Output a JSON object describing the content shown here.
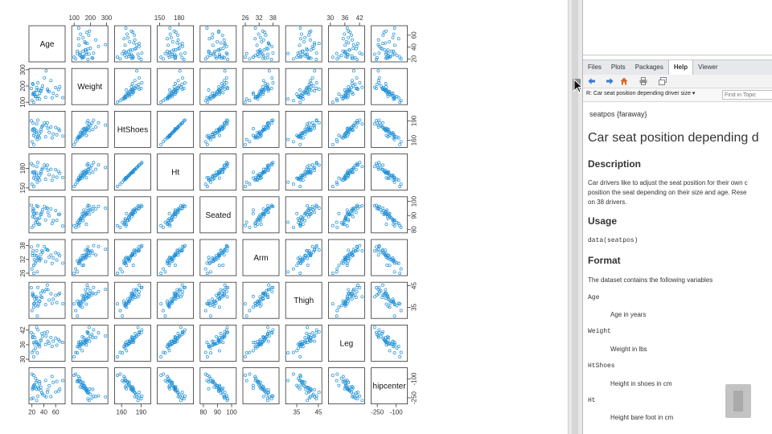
{
  "colors": {
    "point": "#1f8fd6",
    "panel_border": "#333333",
    "axis_text": "#333333"
  },
  "chart_data": {
    "type": "scatter",
    "title": "",
    "variables": [
      "Age",
      "Weight",
      "HtShoes",
      "Ht",
      "Seated",
      "Arm",
      "Thigh",
      "Leg",
      "hipcenter"
    ],
    "axis_ticks": {
      "Age": [
        20,
        40,
        60
      ],
      "Weight": [
        100,
        200,
        300
      ],
      "HtShoes": [
        160,
        190
      ],
      "Ht": [
        150,
        180
      ],
      "Seated": [
        80,
        90,
        100
      ],
      "Arm": [
        26,
        32,
        38
      ],
      "Thigh": [
        35,
        45
      ],
      "Leg": [
        30,
        36,
        42
      ],
      "hipcenter": [
        -250,
        -100
      ]
    },
    "ranges": {
      "Age": [
        19,
        72
      ],
      "Weight": [
        100,
        293
      ],
      "HtShoes": [
        152.8,
        201.2
      ],
      "Ht": [
        150.2,
        198.4
      ],
      "Seated": [
        79.4,
        101.6
      ],
      "Arm": [
        26,
        39.6
      ],
      "Thigh": [
        31,
        45.5
      ],
      "Leg": [
        30.2,
        43.1
      ],
      "hipcenter": [
        -279.2,
        -30.9
      ]
    },
    "observations": [
      {
        "Age": 46,
        "Weight": 180,
        "HtShoes": 187.2,
        "Ht": 184.9,
        "Seated": 95.2,
        "Arm": 36.1,
        "Thigh": 45.3,
        "Leg": 41.3,
        "hipcenter": -206.3
      },
      {
        "Age": 31,
        "Weight": 175,
        "HtShoes": 167.5,
        "Ht": 165.5,
        "Seated": 83.8,
        "Arm": 32.9,
        "Thigh": 36.5,
        "Leg": 35.9,
        "hipcenter": -178.2
      },
      {
        "Age": 23,
        "Weight": 100,
        "HtShoes": 153.6,
        "Ht": 152.2,
        "Seated": 82.9,
        "Arm": 26.0,
        "Thigh": 36.6,
        "Leg": 31.0,
        "hipcenter": -71.7
      },
      {
        "Age": 19,
        "Weight": 185,
        "HtShoes": 190.3,
        "Ht": 187.4,
        "Seated": 97.3,
        "Arm": 37.4,
        "Thigh": 44.1,
        "Leg": 41.0,
        "hipcenter": -257.7
      },
      {
        "Age": 23,
        "Weight": 159,
        "HtShoes": 178.0,
        "Ht": 174.1,
        "Seated": 93.9,
        "Arm": 29.5,
        "Thigh": 40.1,
        "Leg": 36.9,
        "hipcenter": -173.2
      },
      {
        "Age": 47,
        "Weight": 170,
        "HtShoes": 178.7,
        "Ht": 177.0,
        "Seated": 92.4,
        "Arm": 36.0,
        "Thigh": 43.2,
        "Leg": 37.4,
        "hipcenter": -185.2
      },
      {
        "Age": 30,
        "Weight": 137,
        "HtShoes": 165.7,
        "Ht": 164.6,
        "Seated": 87.7,
        "Arm": 32.5,
        "Thigh": 35.6,
        "Leg": 36.2,
        "hipcenter": -164.8
      },
      {
        "Age": 28,
        "Weight": 192,
        "HtShoes": 185.3,
        "Ht": 182.7,
        "Seated": 96.9,
        "Arm": 35.8,
        "Thigh": 39.9,
        "Leg": 43.1,
        "hipcenter": -270.9
      },
      {
        "Age": 23,
        "Weight": 150,
        "HtShoes": 167.6,
        "Ht": 165.0,
        "Seated": 91.4,
        "Arm": 29.4,
        "Thigh": 35.1,
        "Leg": 33.5,
        "hipcenter": -151.8
      },
      {
        "Age": 29,
        "Weight": 120,
        "HtShoes": 161.2,
        "Ht": 158.7,
        "Seated": 85.2,
        "Arm": 26.6,
        "Thigh": 31.0,
        "Leg": 32.6,
        "hipcenter": -113.7
      },
      {
        "Age": 52,
        "Weight": 233,
        "HtShoes": 180.5,
        "Ht": 178.6,
        "Seated": 94.7,
        "Arm": 33.9,
        "Thigh": 41.3,
        "Leg": 39.0,
        "hipcenter": -240.4
      },
      {
        "Age": 72,
        "Weight": 128,
        "HtShoes": 166.6,
        "Ht": 165.9,
        "Seated": 82.6,
        "Arm": 30.4,
        "Thigh": 36.7,
        "Leg": 36.9,
        "hipcenter": -113.3
      },
      {
        "Age": 33,
        "Weight": 120,
        "HtShoes": 163.7,
        "Ht": 162.0,
        "Seated": 83.9,
        "Arm": 31.4,
        "Thigh": 37.9,
        "Leg": 35.2,
        "hipcenter": -122.6
      },
      {
        "Age": 27,
        "Weight": 137,
        "HtShoes": 172.0,
        "Ht": 169.7,
        "Seated": 87.3,
        "Arm": 31.3,
        "Thigh": 37.8,
        "Leg": 37.3,
        "hipcenter": -126.5
      },
      {
        "Age": 30,
        "Weight": 220,
        "HtShoes": 191.3,
        "Ht": 189.0,
        "Seated": 96.4,
        "Arm": 38.0,
        "Thigh": 44.2,
        "Leg": 42.1,
        "hipcenter": -236.0
      },
      {
        "Age": 37,
        "Weight": 185,
        "HtShoes": 181.0,
        "Ht": 178.4,
        "Seated": 92.3,
        "Arm": 35.8,
        "Thigh": 39.6,
        "Leg": 40.6,
        "hipcenter": -210.8
      },
      {
        "Age": 21,
        "Weight": 150,
        "HtShoes": 175.6,
        "Ht": 173.8,
        "Seated": 89.2,
        "Arm": 33.7,
        "Thigh": 40.5,
        "Leg": 39.3,
        "hipcenter": -168.7
      },
      {
        "Age": 67,
        "Weight": 195,
        "HtShoes": 175.1,
        "Ht": 172.5,
        "Seated": 91.0,
        "Arm": 33.6,
        "Thigh": 41.5,
        "Leg": 37.4,
        "hipcenter": -179.6
      },
      {
        "Age": 35,
        "Weight": 168,
        "HtShoes": 173.4,
        "Ht": 171.9,
        "Seated": 90.5,
        "Arm": 32.4,
        "Thigh": 39.9,
        "Leg": 37.9,
        "hipcenter": -165.4
      },
      {
        "Age": 21,
        "Weight": 215,
        "HtShoes": 176.6,
        "Ht": 174.2,
        "Seated": 93.1,
        "Arm": 34.6,
        "Thigh": 41.6,
        "Leg": 38.9,
        "hipcenter": -183.0
      },
      {
        "Age": 43,
        "Weight": 130,
        "HtShoes": 165.5,
        "Ht": 163.2,
        "Seated": 86.8,
        "Arm": 31.1,
        "Thigh": 36.3,
        "Leg": 36.1,
        "hipcenter": -111.9
      },
      {
        "Age": 56,
        "Weight": 155,
        "HtShoes": 169.8,
        "Ht": 167.9,
        "Seated": 86.4,
        "Arm": 32.6,
        "Thigh": 38.8,
        "Leg": 37.4,
        "hipcenter": -127.2
      },
      {
        "Age": 54,
        "Weight": 127,
        "HtShoes": 163.9,
        "Ht": 161.8,
        "Seated": 84.3,
        "Arm": 30.3,
        "Thigh": 36.9,
        "Leg": 35.3,
        "hipcenter": -81.4
      },
      {
        "Age": 25,
        "Weight": 160,
        "HtShoes": 176.8,
        "Ht": 174.8,
        "Seated": 91.6,
        "Arm": 33.8,
        "Thigh": 38.9,
        "Leg": 38.9,
        "hipcenter": -160.1
      },
      {
        "Age": 41,
        "Weight": 250,
        "HtShoes": 187.2,
        "Ht": 185.3,
        "Seated": 96.5,
        "Arm": 37.6,
        "Thigh": 42.3,
        "Leg": 40.9,
        "hipcenter": -233.2
      },
      {
        "Age": 35,
        "Weight": 173,
        "HtShoes": 176.6,
        "Ht": 174.5,
        "Seated": 91.2,
        "Arm": 34.2,
        "Thigh": 41.6,
        "Leg": 37.7,
        "hipcenter": -190.6
      },
      {
        "Age": 22,
        "Weight": 210,
        "HtShoes": 186.6,
        "Ht": 184.5,
        "Seated": 94.9,
        "Arm": 35.7,
        "Thigh": 40.8,
        "Leg": 40.2,
        "hipcenter": -251.6
      },
      {
        "Age": 44,
        "Weight": 293,
        "HtShoes": 183.4,
        "Ht": 181.2,
        "Seated": 95.2,
        "Arm": 36.4,
        "Thigh": 43.3,
        "Leg": 39.6,
        "hipcenter": -242.3
      },
      {
        "Age": 28,
        "Weight": 175,
        "HtShoes": 174.7,
        "Ht": 172.7,
        "Seated": 91.5,
        "Arm": 33.6,
        "Thigh": 39.2,
        "Leg": 37.0,
        "hipcenter": -182.5
      },
      {
        "Age": 60,
        "Weight": 190,
        "HtShoes": 179.8,
        "Ht": 178.0,
        "Seated": 93.6,
        "Arm": 34.9,
        "Thigh": 40.6,
        "Leg": 38.7,
        "hipcenter": -204.0
      },
      {
        "Age": 26,
        "Weight": 135,
        "HtShoes": 165.2,
        "Ht": 163.6,
        "Seated": 84.9,
        "Arm": 30.5,
        "Thigh": 35.8,
        "Leg": 34.6,
        "hipcenter": -95.1
      },
      {
        "Age": 33,
        "Weight": 155,
        "HtShoes": 170.8,
        "Ht": 168.9,
        "Seated": 88.2,
        "Arm": 32.1,
        "Thigh": 37.7,
        "Leg": 36.2,
        "hipcenter": -138.1
      },
      {
        "Age": 62,
        "Weight": 140,
        "HtShoes": 168.5,
        "Ht": 166.4,
        "Seated": 86.6,
        "Arm": 31.8,
        "Thigh": 37.2,
        "Leg": 35.8,
        "hipcenter": -120.3
      },
      {
        "Age": 38,
        "Weight": 200,
        "HtShoes": 182.4,
        "Ht": 180.1,
        "Seated": 94.1,
        "Arm": 35.2,
        "Thigh": 42.7,
        "Leg": 39.4,
        "hipcenter": -221.6
      },
      {
        "Age": 20,
        "Weight": 110,
        "HtShoes": 157.9,
        "Ht": 155.7,
        "Seated": 81.6,
        "Arm": 27.9,
        "Thigh": 33.5,
        "Leg": 32.8,
        "hipcenter": -62.4
      },
      {
        "Age": 49,
        "Weight": 165,
        "HtShoes": 172.4,
        "Ht": 170.2,
        "Seated": 89.8,
        "Arm": 33.0,
        "Thigh": 38.4,
        "Leg": 36.6,
        "hipcenter": -154.7
      },
      {
        "Age": 24,
        "Weight": 145,
        "HtShoes": 171.1,
        "Ht": 169.0,
        "Seated": 88.9,
        "Arm": 31.9,
        "Thigh": 37.0,
        "Leg": 36.4,
        "hipcenter": -146.9
      },
      {
        "Age": 65,
        "Weight": 178,
        "HtShoes": 177.5,
        "Ht": 175.3,
        "Seated": 90.8,
        "Arm": 34.4,
        "Thigh": 40.9,
        "Leg": 38.1,
        "hipcenter": -196.2
      }
    ]
  },
  "tabs": [
    {
      "label": "Files",
      "active": false
    },
    {
      "label": "Plots",
      "active": false
    },
    {
      "label": "Packages",
      "active": false
    },
    {
      "label": "Help",
      "active": true
    },
    {
      "label": "Viewer",
      "active": false
    }
  ],
  "topic_select": "R: Car seat position depending driver size ▾",
  "find_placeholder": "Find in Topic",
  "help": {
    "package_line": "seatpos {faraway}",
    "title": "Car seat position depending d",
    "description_heading": "Description",
    "description_lines": [
      "Car drivers like to adjust the seat position for their own c",
      "position the seat depending on their size and age. Rese",
      "on 38 drivers."
    ],
    "usage_heading": "Usage",
    "usage_code": "data(seatpos)",
    "format_heading": "Format",
    "format_intro": "The dataset contains the following variables",
    "variables": [
      {
        "name": "Age",
        "desc": "Age in years"
      },
      {
        "name": "Weight",
        "desc": "Weight in lbs"
      },
      {
        "name": "HtShoes",
        "desc": "Height in shoes in cm"
      },
      {
        "name": "Ht",
        "desc": "Height bare foot in cm"
      }
    ]
  }
}
